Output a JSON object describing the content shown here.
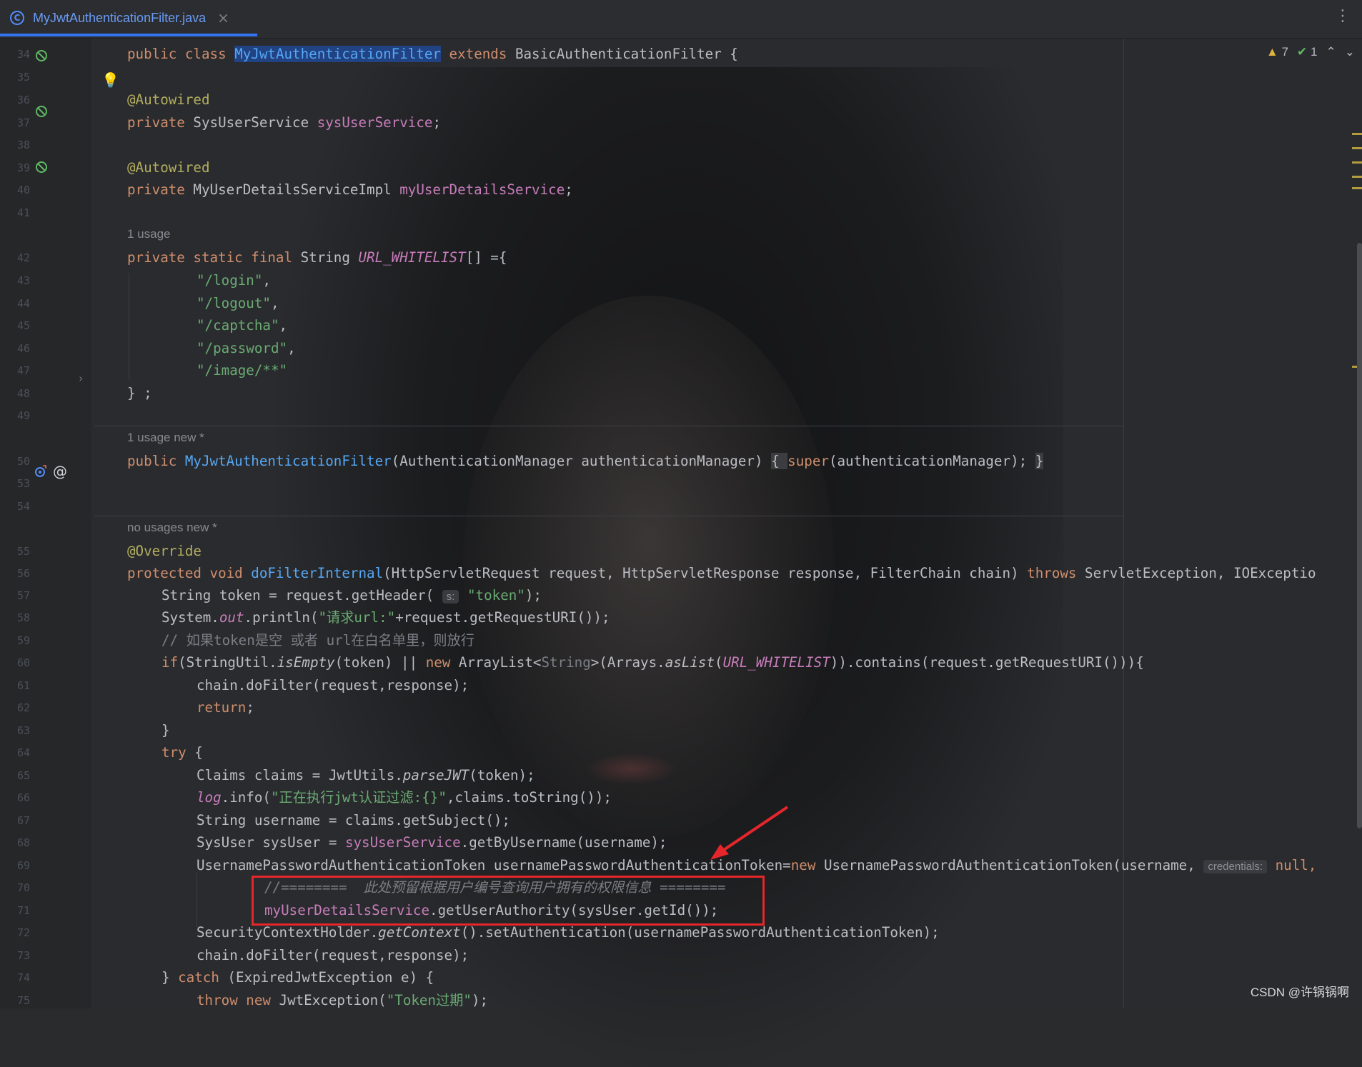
{
  "tab": {
    "filename": "MyJwtAuthenticationFilter.java",
    "icon": "class-icon",
    "close_label": "×"
  },
  "inspections": {
    "warnings": "7",
    "ok": "1"
  },
  "watermark": "CSDN @许锅锅啊",
  "inlays": {
    "usage_42": "1 usage",
    "usage_50": "1 usage   new *",
    "usage_55": "no usages   new *"
  },
  "hints": {
    "s": "s:",
    "credentials": "credentials:"
  },
  "line_numbers": [
    "34",
    "35",
    "36",
    "37",
    "38",
    "39",
    "40",
    "41",
    "42",
    "43",
    "44",
    "45",
    "46",
    "47",
    "48",
    "49",
    "50",
    "53",
    "54",
    "55",
    "56",
    "57",
    "58",
    "59",
    "60",
    "61",
    "62",
    "63",
    "64",
    "65",
    "66",
    "67",
    "68",
    "69",
    "70",
    "71",
    "72",
    "73",
    "74",
    "75"
  ],
  "code": {
    "l34_1": "public class ",
    "l34_2": "MyJwtAuthenticationFilter",
    "l34_3": " extends ",
    "l34_4": "BasicAuthenticationFilter {",
    "l36": "@Autowired",
    "l37_1": "private ",
    "l37_2": "SysUserService ",
    "l37_3": "sysUserService",
    "l37_4": ";",
    "l39": "@Autowired",
    "l40_1": "private ",
    "l40_2": "MyUserDetailsServiceImpl ",
    "l40_3": "myUserDetailsService",
    "l40_4": ";",
    "l42_1": "private static final ",
    "l42_2": "String ",
    "l42_3": "URL_WHITELIST",
    "l42_4": "[] ={",
    "l43": "\"/login\"",
    "l44": "\"/logout\"",
    "l45": "\"/captcha\"",
    "l46": "\"/password\"",
    "l47": "\"/image/**\"",
    "comma": ",",
    "l48": "} ;",
    "l50_1": "public ",
    "l50_2": "MyJwtAuthenticationFilter",
    "l50_3": "(AuthenticationManager authenticationManager) ",
    "l50_4": "{ ",
    "l50_5": "super",
    "l50_6": "(authenticationManager); ",
    "l50_7": "}",
    "l55": "@Override",
    "l56_1": "protected void ",
    "l56_2": "doFilterInternal",
    "l56_3": "(HttpServletRequest request, HttpServletResponse response, FilterChain chain) ",
    "l56_4": "throws ",
    "l56_5": "ServletException, IOExceptio",
    "l57_1": "String token = request.getHeader( ",
    "l57_2": "\"token\"",
    "l57_3": ");",
    "l58_1": "System.",
    "l58_2": "out",
    "l58_3": ".println(",
    "l58_4": "\"请求url:\"",
    "l58_5": "+request.getRequestURI());",
    "l59": "// 如果token是空 或者 url在白名单里，则放行",
    "l60_1": "if",
    "l60_2": "(StringUtil.",
    "l60_3": "isEmpty",
    "l60_4": "(token) || ",
    "l60_5": "new ",
    "l60_6": "ArrayList<",
    "l60_7": "String",
    "l60_8": ">(Arrays.",
    "l60_9": "asList",
    "l60_10": "(",
    "l60_11": "URL_WHITELIST",
    "l60_12": ")).contains(request.getRequestURI())){",
    "l61": "chain.doFilter(request,response);",
    "l62_1": "return",
    "l62_2": ";",
    "l63": "}",
    "l64_1": "try ",
    "l64_2": "{",
    "l65_1": "Claims claims = JwtUtils.",
    "l65_2": "parseJWT",
    "l65_3": "(token);",
    "l66_1": "log",
    "l66_2": ".info(",
    "l66_3": "\"正在执行jwt认证过滤:{}\"",
    "l66_4": ",claims.toString());",
    "l67": "String username = claims.getSubject();",
    "l68_1": "SysUser sysUser = ",
    "l68_2": "sysUserService",
    "l68_3": ".getByUsername(username);",
    "l69_1": "UsernamePasswordAuthenticationToken usernamePasswordAuthenticationToken=",
    "l69_2": "new ",
    "l69_3": "UsernamePasswordAuthenticationToken(username, ",
    "l69_4": "null,",
    "l70": "//========  此处预留根据用户编号查询用户拥有的权限信息 ========",
    "l71_1": "myUserDetailsService",
    "l71_2": ".getUserAuthority(sysUser.getId());",
    "l72_1": "SecurityContextHolder.",
    "l72_2": "getContext",
    "l72_3": "().setAuthentication(usernamePasswordAuthenticationToken);",
    "l73": "chain.doFilter(request,response);",
    "l74_1": "} ",
    "l74_2": "catch ",
    "l74_3": "(ExpiredJwtException e) {",
    "l75_1": "throw new ",
    "l75_2": "JwtException(",
    "l75_3": "\"Token过期\"",
    "l75_4": ");"
  },
  "colors": {
    "keyword": "#cf8e6d",
    "annotation": "#b3ae60",
    "field": "#c77dbb",
    "method": "#56a8f5",
    "string": "#6aab73",
    "comment": "#7a7e85",
    "highlight_box": "#e5262a",
    "arrow": "#e5262a"
  }
}
